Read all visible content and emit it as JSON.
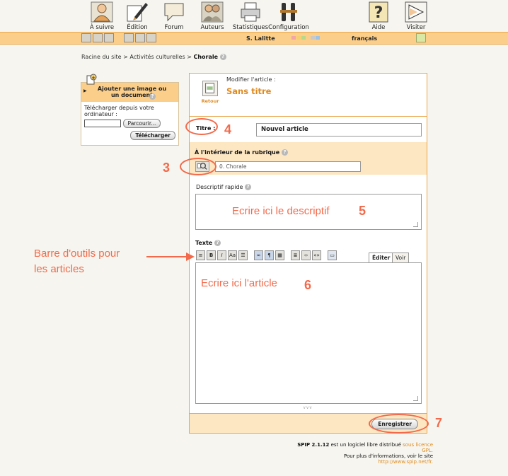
{
  "nav": [
    {
      "label": "À suivre",
      "icon": "person-icon"
    },
    {
      "label": "Édition",
      "icon": "pen-icon"
    },
    {
      "label": "Forum",
      "icon": "speech-bubble-icon"
    },
    {
      "label": "Auteurs",
      "icon": "people-icon"
    },
    {
      "label": "Statistiques",
      "icon": "printer-icon"
    },
    {
      "label": "Configuration",
      "icon": "tools-icon"
    },
    {
      "label": "Aide",
      "icon": "question-icon"
    },
    {
      "label": "Visiter",
      "icon": "arrow-icon"
    }
  ],
  "userbar": {
    "user": "S. Lalitte",
    "language": "français",
    "swatch_colors": [
      "#f4a6a6",
      "#f6d070",
      "#b9d98a",
      "#c9c9c9",
      "#9fc3e6"
    ]
  },
  "breadcrumb": {
    "root": "Racine du site",
    "sep": ">",
    "section": "Activités culturelles",
    "current": "Chorale"
  },
  "upload": {
    "title": "Ajouter une image ou un document",
    "desc": "Télécharger depuis votre ordinateur :",
    "browse": "Parcourir...",
    "submit": "Télécharger"
  },
  "article": {
    "modify_label": "Modifier l'article :",
    "title": "Sans titre",
    "back": "Retour",
    "titre_label": "Titre :",
    "titre_value": "Nouvel article",
    "rubrique_label": "À l'intérieur de la rubrique",
    "rubrique_value": "0. Chorale",
    "descriptif_label": "Descriptif rapide",
    "descriptif_hint": "Ecrire ici le descriptif",
    "texte_label": "Texte",
    "texte_hint": "Ecrire ici l'article",
    "tab_edit": "Éditer",
    "tab_view": "Voir",
    "save": "Enregistrer"
  },
  "annotations": {
    "toolbar_note_line1": "Barre d'outils pour",
    "toolbar_note_line2": "les articles",
    "n3": "3",
    "n4": "4",
    "n5": "5",
    "n6": "6",
    "n7": "7",
    "color": "#f26a4b"
  },
  "footer": {
    "line1_a": "SPIP 2.1.12",
    "line1_b": "est un logiciel libre distribué",
    "line1_link": "sous licence GPL.",
    "line2_a": "Pour plus d'informations, voir le site",
    "line2_link": "http://www.spip.net/fr."
  }
}
